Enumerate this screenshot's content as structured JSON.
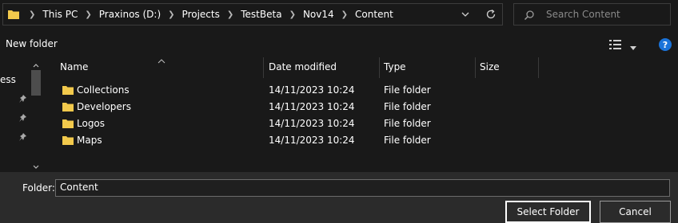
{
  "breadcrumb": [
    "This PC",
    "Praxinos (D:)",
    "Projects",
    "TestBeta",
    "Nov14",
    "Content"
  ],
  "search": {
    "placeholder": "Search Content"
  },
  "toolbar": {
    "new_folder": "New folder",
    "help": "?"
  },
  "nav": {
    "partial_label": "ess"
  },
  "columns": {
    "name": "Name",
    "date": "Date modified",
    "type": "Type",
    "size": "Size"
  },
  "files": [
    {
      "name": "Collections",
      "date": "14/11/2023 10:24",
      "type": "File folder",
      "size": ""
    },
    {
      "name": "Developers",
      "date": "14/11/2023 10:24",
      "type": "File folder",
      "size": ""
    },
    {
      "name": "Logos",
      "date": "14/11/2023 10:24",
      "type": "File folder",
      "size": ""
    },
    {
      "name": "Maps",
      "date": "14/11/2023 10:24",
      "type": "File folder",
      "size": ""
    }
  ],
  "footer": {
    "folder_label": "Folder:",
    "folder_value": "Content",
    "select_button": "Select Folder",
    "cancel_button": "Cancel"
  },
  "colors": {
    "background": "#191919",
    "footer": "#2b2b2b",
    "folder_icon": "#f2c94c",
    "help_badge": "#1a73d9"
  }
}
